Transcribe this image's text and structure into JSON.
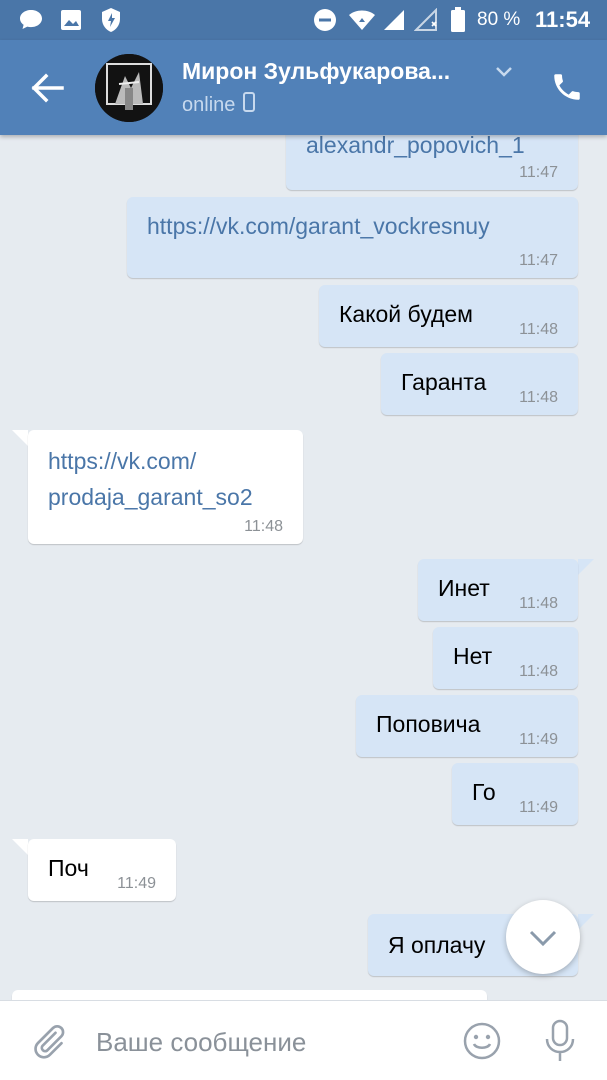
{
  "status_bar": {
    "battery_percent": "80 %",
    "time": "11:54",
    "icons": [
      "chat-bubble-icon",
      "image-icon",
      "shield-icon",
      "do-not-disturb-icon",
      "wifi-icon",
      "signal-icon",
      "signal-empty-icon",
      "battery-icon"
    ]
  },
  "header": {
    "contact_name": "Мирон Зульфукарова...",
    "status": "online",
    "icons": [
      "back-arrow-icon",
      "chevron-down-icon",
      "mobile-icon",
      "phone-icon"
    ]
  },
  "messages": [
    {
      "dir": "out",
      "text": "alexandr_popovich_1",
      "time": "11:47",
      "is_link": true
    },
    {
      "dir": "out",
      "text": "https://vk.com/garant_vockresnuy",
      "time": "11:47",
      "is_link": true
    },
    {
      "dir": "out",
      "text": "Какой будем",
      "time": "11:48",
      "is_link": false
    },
    {
      "dir": "out",
      "text": "Гаранта",
      "time": "11:48",
      "is_link": false
    },
    {
      "dir": "in",
      "text_line1": "https://vk.com/",
      "text_line2": "prodaja_garant_so2",
      "time": "11:48",
      "is_link": true
    },
    {
      "dir": "out",
      "text": "Инет",
      "time": "11:48",
      "is_link": false
    },
    {
      "dir": "out",
      "text": "Нет",
      "time": "11:48",
      "is_link": false
    },
    {
      "dir": "out",
      "text": "Поповича",
      "time": "11:49",
      "is_link": false
    },
    {
      "dir": "out",
      "text": "Го",
      "time": "11:49",
      "is_link": false
    },
    {
      "dir": "in",
      "text": "Поч",
      "time": "11:49",
      "is_link": false
    },
    {
      "dir": "out",
      "text": "Я оплачу",
      "time": "",
      "is_link": false
    }
  ],
  "input": {
    "placeholder": "Ваше сообщение"
  },
  "colors": {
    "header": "#5181b8",
    "statusbar": "#4a76a8",
    "outgoing_bubble": "#d6e5f6",
    "incoming_bubble": "#ffffff",
    "background": "#e6ebf0",
    "link": "#4a76a8"
  }
}
